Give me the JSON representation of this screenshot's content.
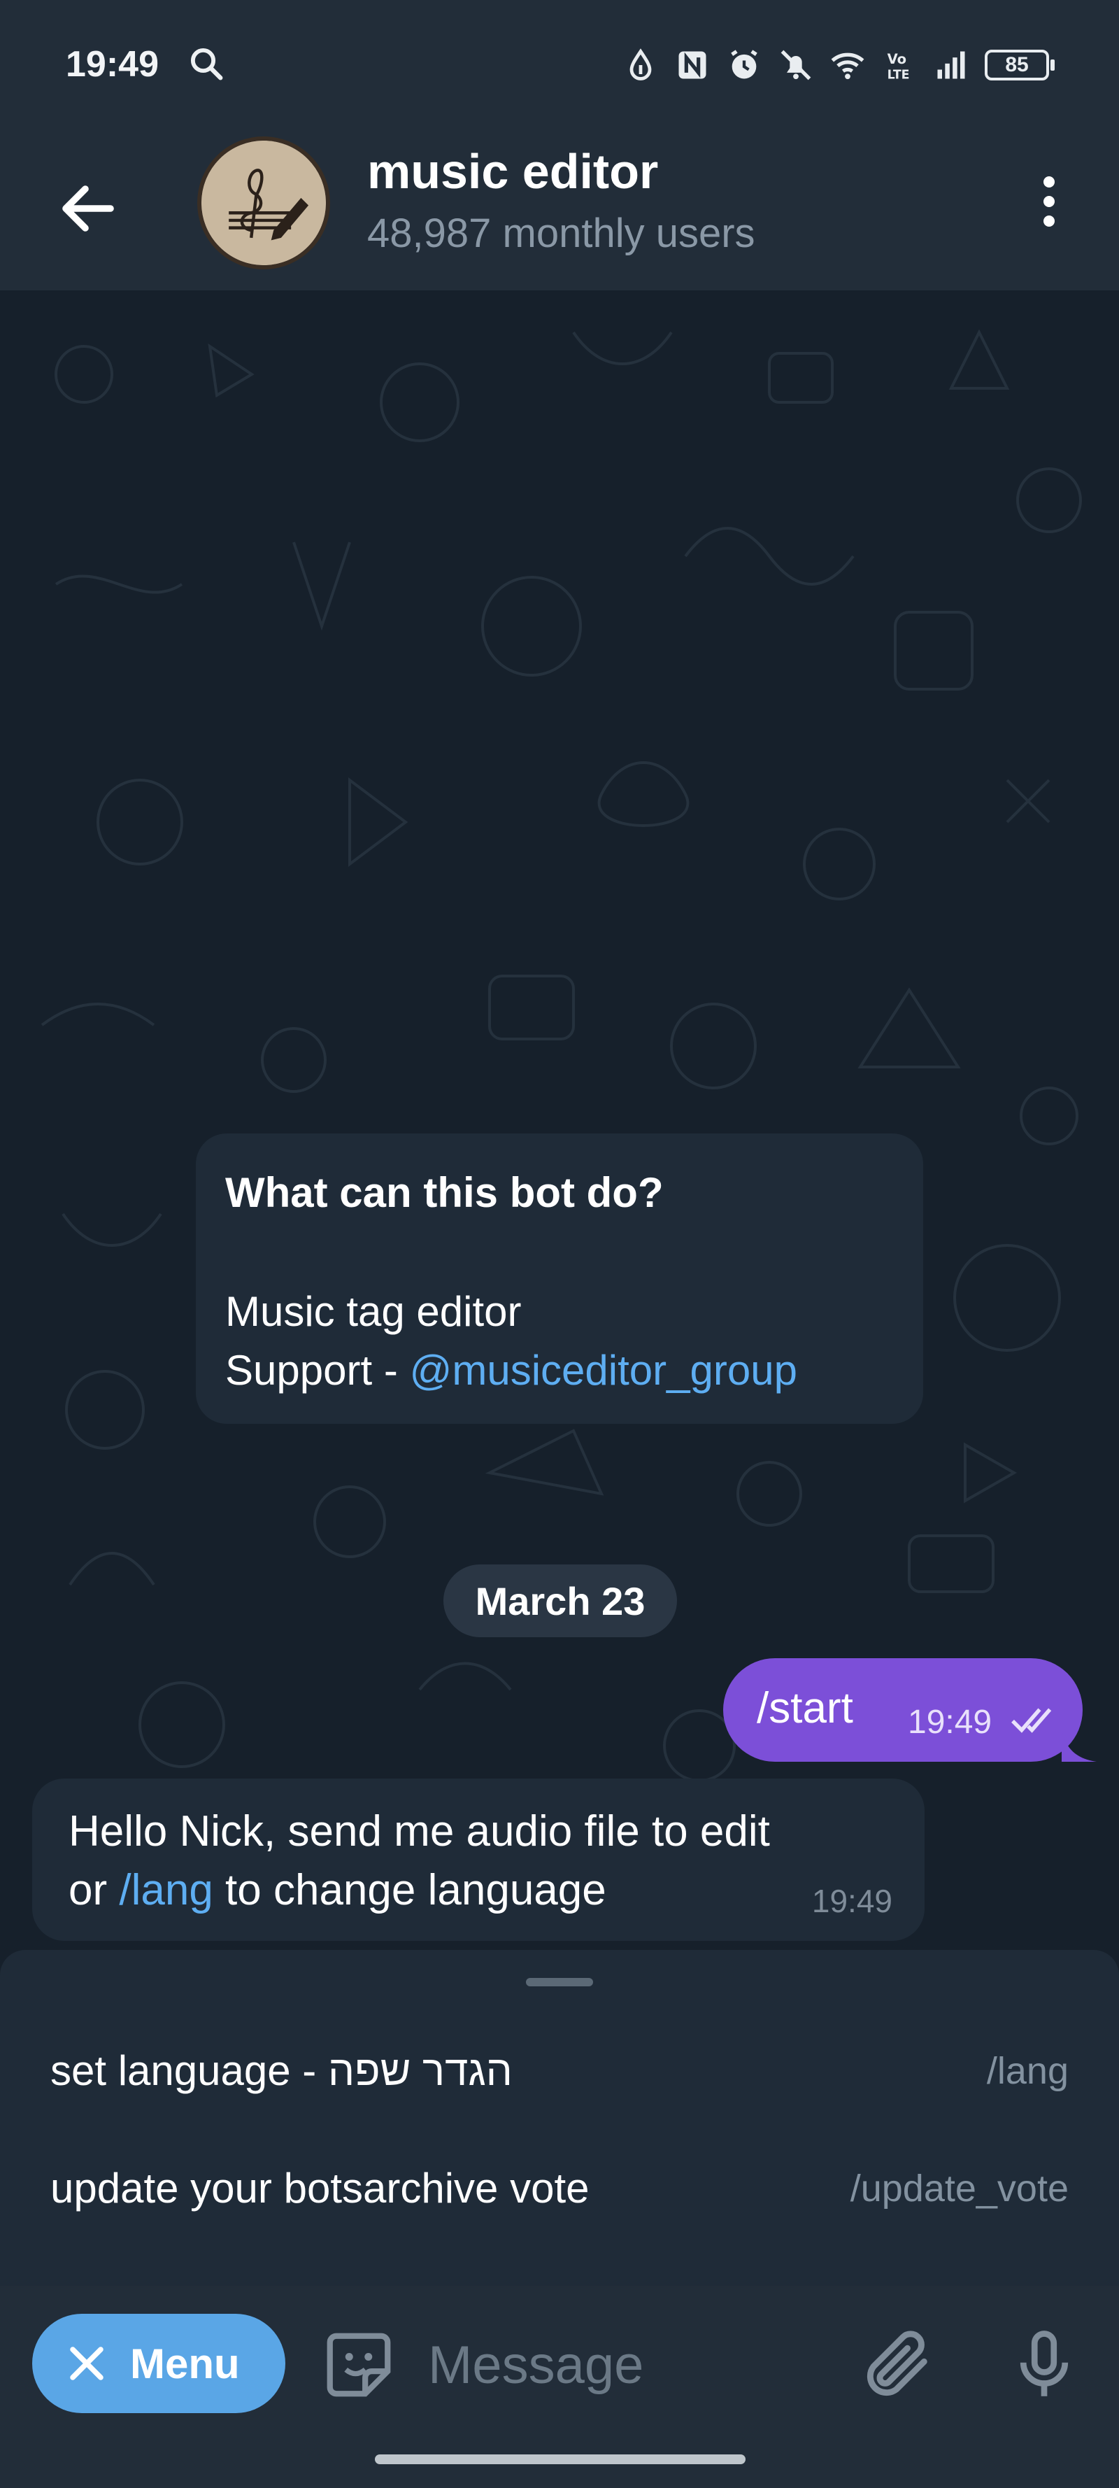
{
  "status_bar": {
    "time": "19:49",
    "battery": "85",
    "icons": [
      "search-icon",
      "data-saver-icon",
      "nfc-icon",
      "alarm-icon",
      "mute-icon",
      "wifi-icon",
      "volte-icon",
      "signal-icon",
      "battery-icon"
    ]
  },
  "header": {
    "title": "music editor",
    "subtitle": "48,987 monthly users"
  },
  "bot_info": {
    "heading": "What can this bot do?",
    "line1": "Music tag editor",
    "line2_prefix": "Support - ",
    "line2_link": "@musiceditor_group"
  },
  "date_separator": "March 23",
  "messages": [
    {
      "direction": "outgoing",
      "text": "/start",
      "time": "19:49",
      "color": "#7c4fd8"
    },
    {
      "direction": "incoming",
      "line1": "Hello Nick, send me audio file to edit",
      "line2_prefix": "or ",
      "line2_link": "/lang",
      "line2_suffix": " to change language",
      "time": "19:49"
    }
  ],
  "commands": [
    {
      "label": "set language - הגדר שפה",
      "command": "/lang"
    },
    {
      "label": "update your botsarchive vote",
      "command": "/update_vote"
    }
  ],
  "input_bar": {
    "menu_label": "Menu",
    "placeholder": "Message"
  },
  "colors": {
    "background": "#16202b",
    "panel": "#222d39",
    "bubble": "#1f2b38",
    "accent": "#5aa6e6",
    "outgoing": "#7c4fd8",
    "link": "#5eaef2"
  }
}
